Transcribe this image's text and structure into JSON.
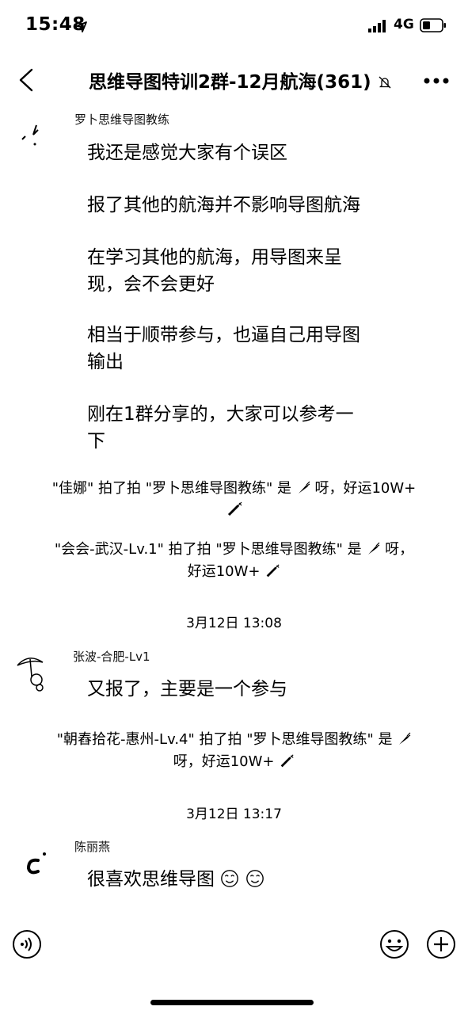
{
  "status_bar": {
    "time": "15:48",
    "network": "4G"
  },
  "nav": {
    "title": "思维导图特训2群-12月航海(361)"
  },
  "messages": [
    {
      "sender": "罗卜思维导图教练",
      "paragraphs": [
        "我还是感觉大家有个误区",
        "报了其他的航海并不影响导图航海",
        "在学习其他的航海，用导图来呈",
        "现，会不会更好",
        "相当于顺带参与，也逼自己用导图",
        "输出",
        "刚在1群分享的，大家可以参考一",
        "下"
      ]
    },
    {
      "sender": "张波-合肥-Lv1",
      "text": "又报了，主要是一个参与"
    },
    {
      "sender": "陈丽燕",
      "text": "很喜欢思维导图"
    }
  ],
  "system": [
    {
      "line1": "\"佳娜\" 拍了拍 \"罗卜思维导图教练\" 是",
      "line1b": "呀，好运10W+"
    },
    {
      "line1": "\"会会-武汉-Lv.1\" 拍了拍 \"罗卜思维导图教练\" 是",
      "line1b": "呀，",
      "line2": "好运10W+"
    },
    {
      "line1": "\"朝舂拾花-惠州-Lv.4\" 拍了拍 \"罗卜思维导图教练\" 是",
      "line2": "呀，好运10W+"
    }
  ],
  "timestamps": [
    "3月12日 13:08",
    "3月12日 13:17"
  ],
  "icons": {
    "back": "chevron-left-icon",
    "mute": "bell-slash-icon",
    "more": "ellipsis-icon",
    "voice": "voice-icon",
    "emoji": "emoji-icon",
    "plus": "plus-icon"
  }
}
